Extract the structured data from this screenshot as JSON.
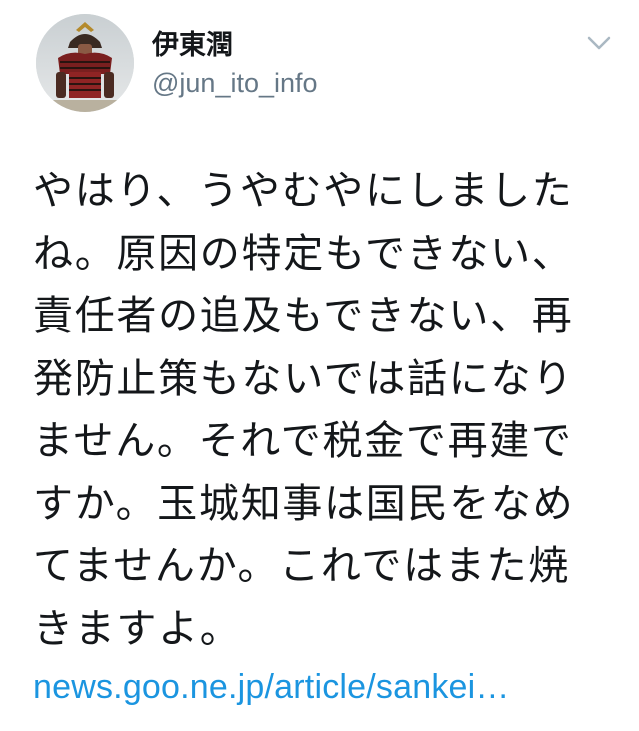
{
  "author": {
    "display_name": "伊東潤",
    "handle": "@jun_ito_info",
    "avatar_icon": "samurai-armor-avatar"
  },
  "menu": {
    "caret_icon": "chevron-down-icon"
  },
  "tweet": {
    "lines": [
      "やはり、うやむやにしました",
      "ね。原因の特定もできない、",
      "責任者の追及もできない、再",
      "発防止策もないでは話になり",
      "ません。それで税金で再建で",
      "すか。玉城知事は国民をなめ",
      "てませんか。これではまた焼",
      "きますよ。"
    ],
    "link_text": "news.goo.ne.jp/article/sankei…"
  },
  "colors": {
    "text": "#14171a",
    "secondary": "#657786",
    "link": "#1b95e0",
    "caret": "#aab8c2"
  }
}
